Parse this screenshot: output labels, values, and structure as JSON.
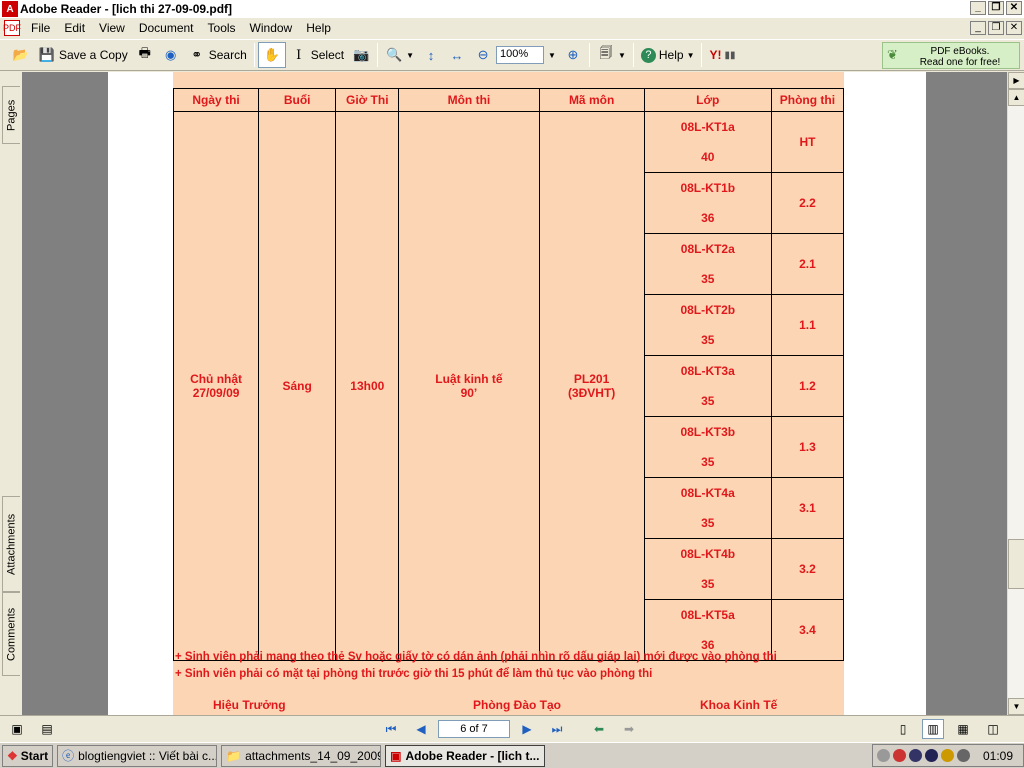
{
  "window": {
    "title": "Adobe Reader - [lich thi 27-09-09.pdf]",
    "controls": [
      "_",
      "❐",
      "✕"
    ]
  },
  "menu": [
    "File",
    "Edit",
    "View",
    "Document",
    "Tools",
    "Window",
    "Help"
  ],
  "toolbar": {
    "save_copy_label": "Save a Copy",
    "search_label": "Search",
    "select_label": "Select",
    "zoom_value": "100%",
    "help_label": "Help",
    "ad_line1": "PDF eBooks.",
    "ad_line2": "Read one for free!"
  },
  "leftnav": {
    "tabs": [
      "Pages",
      "Attachments",
      "Comments"
    ]
  },
  "schedule": {
    "headers": [
      "Ngày thi",
      "Buổi",
      "Giờ Thi",
      "Môn thi",
      "Mã môn",
      "Lớp",
      "Phòng thi"
    ],
    "date_line1": "Chủ nhật",
    "date_line2": "27/09/09",
    "session": "Sáng",
    "time": "13h00",
    "subject_line1": "Luật kinh tế",
    "subject_line2": "90’",
    "code_line1": "PL201",
    "code_line2": "(3ĐVHT)",
    "rows": [
      {
        "class": "08L-KT1a",
        "count": "40",
        "room": "HT"
      },
      {
        "class": "08L-KT1b",
        "count": "36",
        "room": "2.2"
      },
      {
        "class": "08L-KT2a",
        "count": "35",
        "room": "2.1"
      },
      {
        "class": "08L-KT2b",
        "count": "35",
        "room": "1.1"
      },
      {
        "class": "08L-KT3a",
        "count": "35",
        "room": "1.2"
      },
      {
        "class": "08L-KT3b",
        "count": "35",
        "room": "1.3"
      },
      {
        "class": "08L-KT4a",
        "count": "35",
        "room": "3.1"
      },
      {
        "class": "08L-KT4b",
        "count": "35",
        "room": "3.2"
      },
      {
        "class": "08L-KT5a",
        "count": "36",
        "room": "3.4"
      }
    ],
    "note1": "+ Sinh viên phải mang theo thẻ Sv hoặc giấy tờ có dán ảnh (phải nhìn rõ dấu giáp lai) mới được vào phòng thi",
    "note2": "+ Sinh viên phải có mặt tại phòng thi trước giờ thi 15 phút để làm thủ tục vào phòng thi",
    "sig_left": "Hiệu Trưởng",
    "sig_mid": "Phòng Đào Tạo",
    "sig_right": "Khoa Kinh Tế"
  },
  "status": {
    "page_indicator": "6 of 7"
  },
  "taskbar": {
    "start_label": "Start",
    "tasks": [
      {
        "label": "blogtiengviet :: Viết bài c...",
        "active": false
      },
      {
        "label": "attachments_14_09_2009",
        "active": false
      },
      {
        "label": "Adobe Reader - [lich t...",
        "active": true
      }
    ],
    "clock": "01:09"
  },
  "colors": {
    "schedule_bg": "#FCD5B4",
    "schedule_text": "#E0181B",
    "doc_bg": "#808080"
  }
}
